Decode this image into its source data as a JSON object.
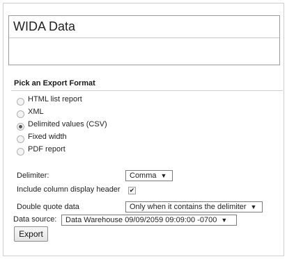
{
  "title_field": {
    "value": "WIDA Data"
  },
  "export_format": {
    "heading": "Pick an Export Format",
    "options": [
      {
        "label": "HTML list report",
        "selected": false
      },
      {
        "label": "XML",
        "selected": false
      },
      {
        "label": "Delimited values (CSV)",
        "selected": true
      },
      {
        "label": "Fixed width",
        "selected": false
      },
      {
        "label": "PDF report",
        "selected": false
      }
    ]
  },
  "settings": {
    "delimiter_label": "Delimiter:",
    "delimiter_value": "Comma",
    "header_label": "Include column display header",
    "header_checked": true,
    "quote_label": "Double quote data",
    "quote_value": "Only when it contains the delimiter",
    "source_label": "Data source:",
    "source_value": "Data Warehouse 09/09/2059 09:09:00 -0700"
  },
  "actions": {
    "export_label": "Export"
  },
  "icons": {
    "dropdown": "chevron-down-icon",
    "check": "checkmark-icon"
  }
}
